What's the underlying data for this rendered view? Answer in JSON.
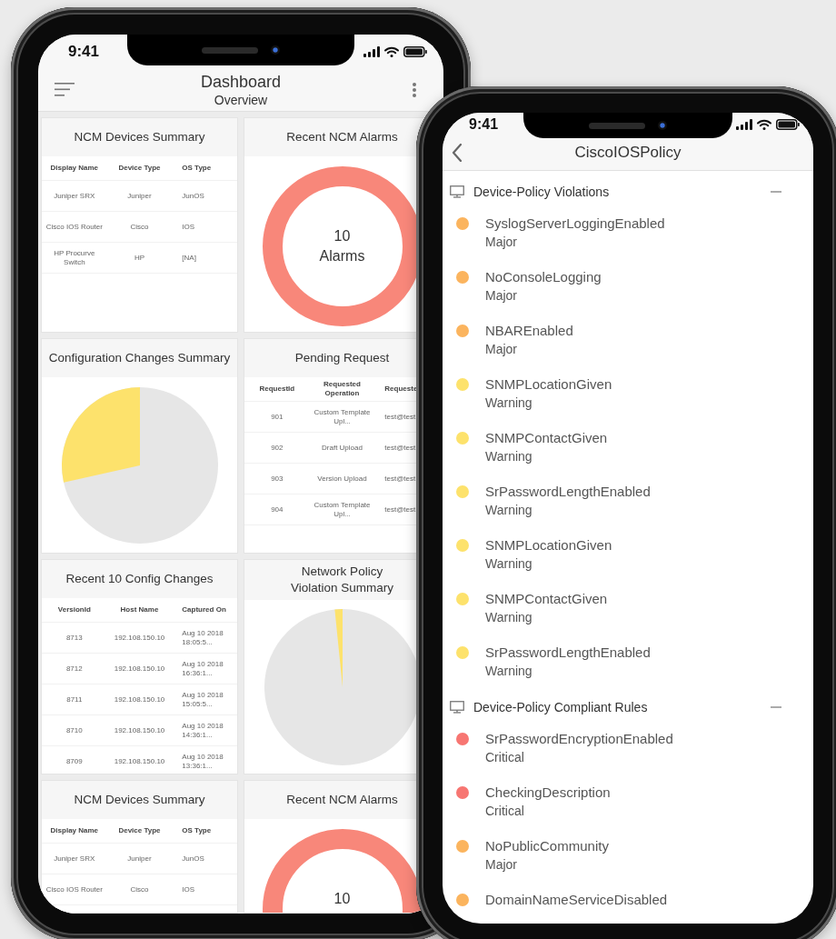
{
  "dashboard": {
    "status_time": "9:41",
    "title": "Dashboard",
    "subtitle": "Overview",
    "cards": [
      {
        "kind": "table",
        "title": "NCM Devices Summary",
        "columns": [
          "Display Name",
          "Device Type",
          "OS Type"
        ],
        "rows": [
          [
            "Juniper SRX",
            "Juniper",
            "JunOS"
          ],
          [
            "Cisco IOS Router",
            "Cisco",
            "IOS"
          ],
          [
            "HP Procurve Switch",
            "HP",
            "[NA]"
          ]
        ]
      },
      {
        "kind": "donut",
        "title": "Recent NCM Alarms",
        "value": "10",
        "label": "Alarms"
      },
      {
        "kind": "pie",
        "title": "Configuration Changes Summary"
      },
      {
        "kind": "table",
        "title": "Pending Request",
        "columns": [
          "RequestId",
          "Requested Operation",
          "Requeste"
        ],
        "rows": [
          [
            "901",
            "Custom Template Upl...",
            "test@test."
          ],
          [
            "902",
            "Draft Upload",
            "test@test."
          ],
          [
            "903",
            "Version Upload",
            "test@test."
          ],
          [
            "904",
            "Custom Template Upl...",
            "test@test."
          ]
        ]
      },
      {
        "kind": "table",
        "title": "Recent 10 Config Changes",
        "columns": [
          "VersionId",
          "Host Name",
          "Captured On"
        ],
        "rows": [
          [
            "8713",
            "192.108.150.10",
            "Aug 10 2018 18:05:5..."
          ],
          [
            "8712",
            "192.108.150.10",
            "Aug 10 2018 16:36:1..."
          ],
          [
            "8711",
            "192.108.150.10",
            "Aug 10 2018 15:05:5..."
          ],
          [
            "8710",
            "192.108.150.10",
            "Aug 10 2018 14:36:1..."
          ],
          [
            "8709",
            "192.108.150.10",
            "Aug 10 2018 13:36:1..."
          ]
        ]
      },
      {
        "kind": "pie",
        "title": "Network Policy Violation Summary"
      },
      {
        "kind": "table",
        "title": "NCM Devices Summary",
        "columns": [
          "Display Name",
          "Device Type",
          "OS Type"
        ],
        "rows": [
          [
            "Juniper SRX",
            "Juniper",
            "JunOS"
          ],
          [
            "Cisco IOS Router",
            "Cisco",
            "IOS"
          ]
        ]
      },
      {
        "kind": "donut",
        "title": "Recent NCM Alarms",
        "value": "10"
      }
    ]
  },
  "policy": {
    "status_time": "9:41",
    "title": "CiscoIOSPolicy",
    "sections": [
      {
        "title": "Device-Policy Violations",
        "expanded": true,
        "items": [
          {
            "name": "SyslogServerLoggingEnabled",
            "severity": "Major",
            "color": "#fbb45e"
          },
          {
            "name": "NoConsoleLogging",
            "severity": "Major",
            "color": "#fbb45e"
          },
          {
            "name": "NBAREnabled",
            "severity": "Major",
            "color": "#fbb45e"
          },
          {
            "name": "SNMPLocationGiven",
            "severity": "Warning",
            "color": "#fde26c"
          },
          {
            "name": "SNMPContactGiven",
            "severity": "Warning",
            "color": "#fde26c"
          },
          {
            "name": "SrPasswordLengthEnabled",
            "severity": "Warning",
            "color": "#fde26c"
          },
          {
            "name": "SNMPLocationGiven",
            "severity": "Warning",
            "color": "#fde26c"
          },
          {
            "name": "SNMPContactGiven",
            "severity": "Warning",
            "color": "#fde26c"
          },
          {
            "name": "SrPasswordLengthEnabled",
            "severity": "Warning",
            "color": "#fde26c"
          }
        ]
      },
      {
        "title": "Device-Policy Compliant Rules",
        "expanded": true,
        "items": [
          {
            "name": "SrPasswordEncryptionEnabled",
            "severity": "Critical",
            "color": "#f77672"
          },
          {
            "name": "CheckingDescription",
            "severity": "Critical",
            "color": "#f77672"
          },
          {
            "name": "NoPublicCommunity",
            "severity": "Major",
            "color": "#fbb45e"
          },
          {
            "name": "DomainNameServiceDisabled",
            "color": "#fbb45e"
          }
        ]
      }
    ]
  }
}
